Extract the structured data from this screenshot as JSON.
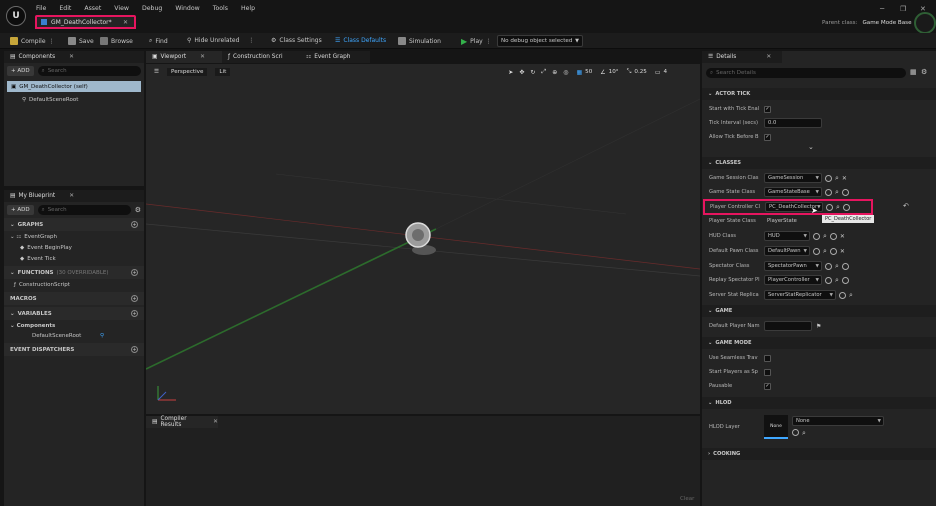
{
  "menu": [
    "File",
    "Edit",
    "Asset",
    "View",
    "Debug",
    "Window",
    "Tools",
    "Help"
  ],
  "document_tab": {
    "label": "GM_DeathCollector*"
  },
  "parent_class": {
    "label": "Parent class:",
    "value": "Game Mode Base"
  },
  "toolbar": {
    "compile": "Compile",
    "save": "Save",
    "browse": "Browse",
    "find": "Find",
    "hide_unrelated": "Hide Unrelated",
    "class_settings": "Class Settings",
    "class_defaults": "Class Defaults",
    "simulation": "Simulation",
    "play": "Play",
    "debug_object": "No debug object selected"
  },
  "components": {
    "tab": "Components",
    "add": "+ ADD",
    "search_placeholder": "Search",
    "items": [
      "GM_DeathCollector (self)",
      "DefaultSceneRoot"
    ]
  },
  "my_blueprint": {
    "tab": "My Blueprint",
    "add": "+ ADD",
    "search_placeholder": "Search",
    "graphs_header": "GRAPHS",
    "event_graph": "EventGraph",
    "events": [
      "Event BeginPlay",
      "Event Tick"
    ],
    "functions_header": "FUNCTIONS",
    "functions_overridable": "(30 OVERRIDABLE)",
    "construction_script": "ConstructionScript",
    "macros_header": "MACROS",
    "variables_header": "VARIABLES",
    "components_label": "Components",
    "default_scene_root": "DefaultSceneRoot",
    "dispatchers_header": "EVENT DISPATCHERS"
  },
  "center_tabs": {
    "viewport": "Viewport",
    "construction": "Construction Scri",
    "event_graph": "Event Graph"
  },
  "viewport_toolbar": {
    "perspective": "Perspective",
    "lit": "Lit",
    "grid": "50",
    "angle": "10°",
    "scale": "0.25",
    "camera": "4"
  },
  "compiler": {
    "tab": "Compiler Results",
    "clear": "Clear"
  },
  "details": {
    "tab": "Details",
    "search_placeholder": "Search Details",
    "actor_tick": {
      "header": "ACTOR TICK",
      "start_with_tick": "Start with Tick Enal",
      "tick_interval_label": "Tick Interval (secs)",
      "tick_interval_value": "0.0",
      "allow_tick": "Allow Tick Before B"
    },
    "classes": {
      "header": "CLASSES",
      "rows": [
        {
          "label": "Game Session Clas",
          "value": "GameSession"
        },
        {
          "label": "Game State Class",
          "value": "GameStateBase"
        },
        {
          "label": "Player Controller Cl",
          "value": "PC_DeathCollector"
        },
        {
          "label": "Player State Class",
          "value": "PlayerState"
        },
        {
          "label": "HUD Class",
          "value": "HUD"
        },
        {
          "label": "Default Pawn Class",
          "value": "DefaultPawn"
        },
        {
          "label": "Spectator Class",
          "value": "SpectatorPawn"
        },
        {
          "label": "Replay Spectator Pl",
          "value": "PlayerController"
        },
        {
          "label": "Server Stat Replica",
          "value": "ServerStatReplicator"
        }
      ],
      "tooltip": "PC_DeathCollector"
    },
    "game": {
      "header": "GAME",
      "default_player_name": "Default Player Nam"
    },
    "game_mode": {
      "header": "GAME MODE",
      "use_seamless": "Use Seamless Trav",
      "start_players": "Start Players as Sp",
      "pausable": "Pausable"
    },
    "hlod": {
      "header": "HLOD",
      "layer_label": "HLOD Layer",
      "thumb": "None",
      "value": "None"
    },
    "cooking": {
      "header": "COOKING"
    }
  },
  "colors": {
    "highlight": "#e6155f",
    "accent": "#3fa7ff",
    "play": "#34b24b"
  }
}
